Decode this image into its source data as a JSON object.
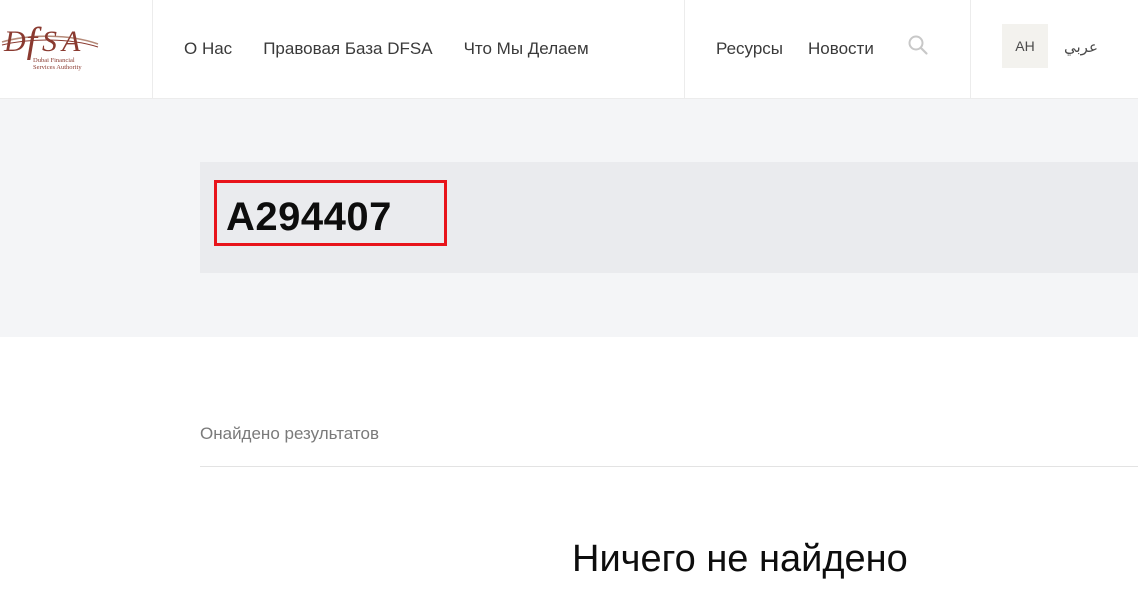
{
  "header": {
    "logo": {
      "mark": "DFSA",
      "subtitle_line1": "Dubai Financial",
      "subtitle_line2": "Services Authority",
      "color": "#8a3a30"
    },
    "nav_left": [
      {
        "label": "О Нас"
      },
      {
        "label": "Правовая База DFSA"
      },
      {
        "label": "Что Мы Делаем"
      }
    ],
    "nav_right": [
      {
        "label": "Ресурсы"
      },
      {
        "label": "Новости"
      }
    ],
    "search_icon": "search-icon",
    "languages": {
      "active": "AH",
      "arabic": "عربي"
    }
  },
  "hero": {
    "query": "A294407",
    "highlight_color": "#e8141b"
  },
  "results": {
    "count_text": "Онайдено результатов",
    "empty_text": "Ничего не найдено"
  }
}
